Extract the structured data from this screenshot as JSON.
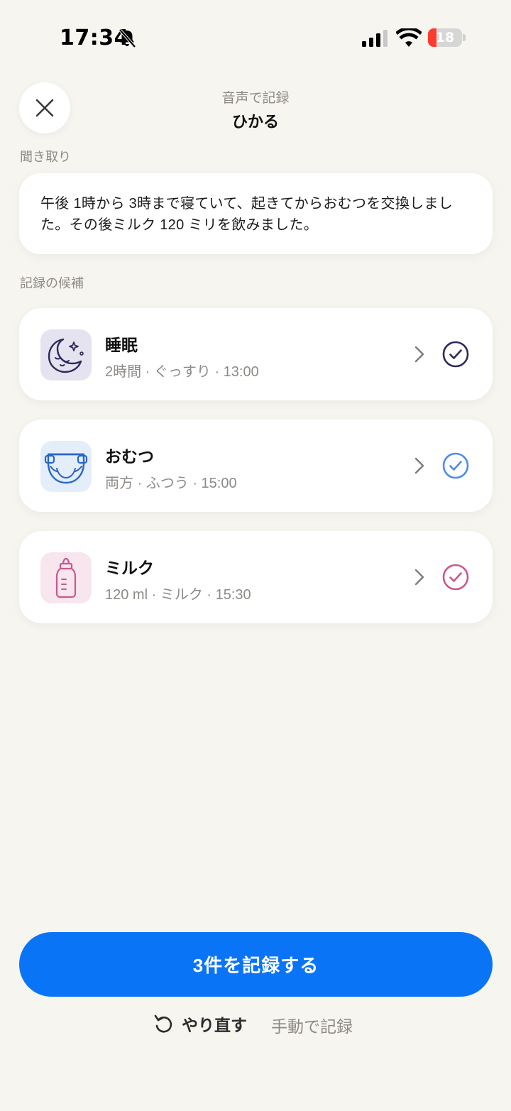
{
  "status_bar": {
    "time": "17:34",
    "battery_level": "18",
    "icons": [
      "bell-slash-icon",
      "cellular-signal-icon",
      "wifi-icon",
      "battery-icon"
    ]
  },
  "header": {
    "subtitle": "音声で記録",
    "title": "ひかる",
    "close_icon": "close-icon"
  },
  "transcript": {
    "label": "聞き取り",
    "text": "午後 1時から 3時まで寝ていて、起きてからおむつを交換しました。その後ミルク 120 ミリを飲みました。"
  },
  "candidates": {
    "label": "記録の候補",
    "items": [
      {
        "title": "睡眠",
        "detail": "2時間 · ぐっすり · 13:00",
        "icon": "moon-icon",
        "tile_color": "#e4e3ef",
        "accent": "#2d2a5e",
        "checked": true
      },
      {
        "title": "おむつ",
        "detail": "両方 · ふつう · 15:00",
        "icon": "diaper-icon",
        "tile_color": "#e4eefb",
        "accent": "#4a8ee8",
        "checked": true
      },
      {
        "title": "ミルク",
        "detail": "120 ml · ミルク · 15:30",
        "icon": "baby-bottle-icon",
        "tile_color": "#f8e6ee",
        "accent": "#c9588f",
        "checked": true
      }
    ]
  },
  "actions": {
    "primary": "3件を記録する",
    "redo": "やり直す",
    "manual": "手動で記録"
  },
  "colors": {
    "background": "#f7f5ef",
    "primary_button": "#0a74f7",
    "battery_low": "#ff3b30"
  }
}
